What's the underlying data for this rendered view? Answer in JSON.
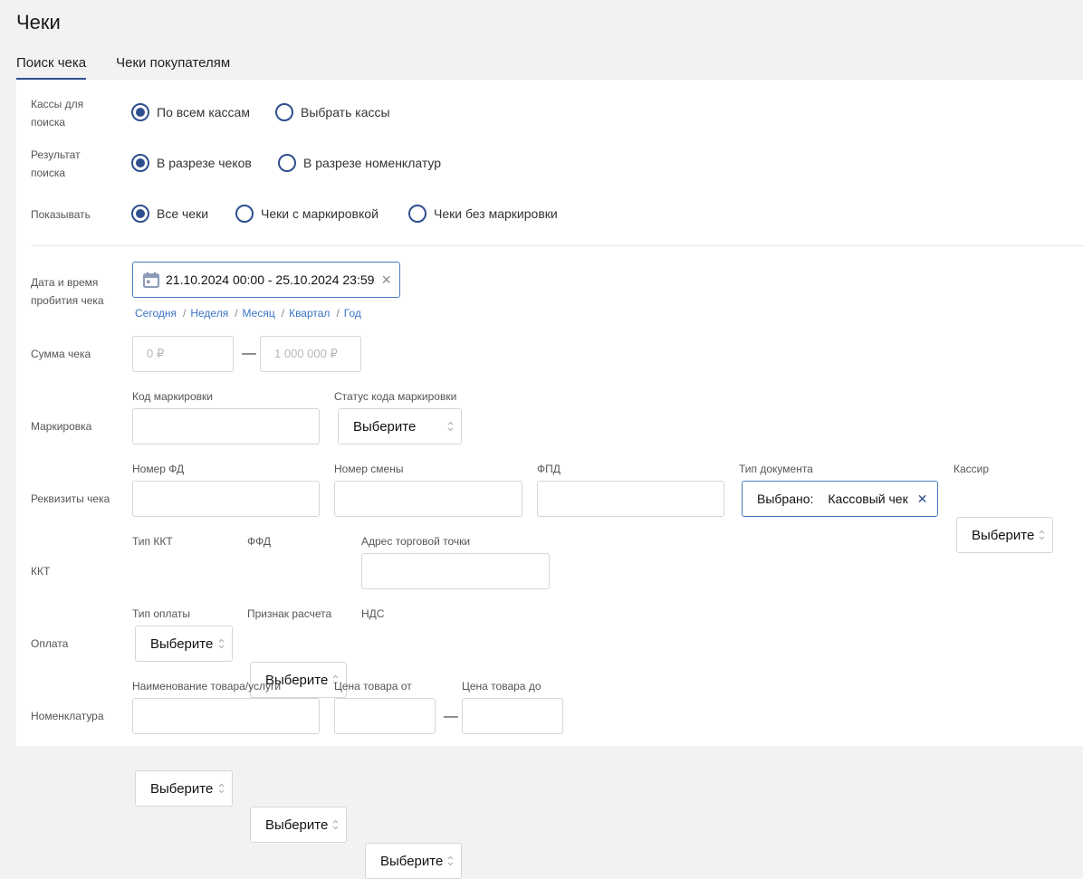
{
  "title": "Чеки",
  "tabs": [
    {
      "label": "Поиск чека"
    },
    {
      "label": "Чеки покупателям"
    }
  ],
  "filters": {
    "registers": {
      "label": "Кассы для поиска",
      "options": [
        "По всем кассам",
        "Выбрать кассы"
      ],
      "selected": "По всем кассам"
    },
    "result": {
      "label": "Результат поиска",
      "options": [
        "В разрезе чеков",
        "В разрезе номенклатур"
      ],
      "selected": "В разрезе чеков"
    },
    "show": {
      "label": "Показывать",
      "options": [
        "Все чеки",
        "Чеки с маркировкой",
        "Чеки без маркировки"
      ],
      "selected": "Все чеки"
    }
  },
  "date": {
    "label": "Дата и время пробития чека",
    "value": "21.10.2024 00:00 - 25.10.2024 23:59",
    "clear": "×",
    "quick": [
      "Сегодня",
      "Неделя",
      "Месяц",
      "Квартал",
      "Год"
    ],
    "sep": "/"
  },
  "sum": {
    "label": "Сумма чека",
    "from_placeholder": "0 ₽",
    "to_placeholder": "1 000 000 ₽",
    "dash": "—"
  },
  "marking": {
    "label": "Маркировка",
    "code_label": "Код маркировки",
    "status_label": "Статус кода маркировки",
    "status_value": "Выберите"
  },
  "requisites": {
    "label": "Реквизиты чека",
    "fd_label": "Номер ФД",
    "shift_label": "Номер смены",
    "fpd_label": "ФПД",
    "doc_type_label": "Тип документа",
    "doc_type_prefix": "Выбрано:",
    "doc_type_value": "Кассовый чек",
    "doc_type_clear": "✕",
    "cashier_label": "Кассир",
    "cashier_value": "Выберите"
  },
  "kkt": {
    "label": "ККТ",
    "type_label": "Тип ККТ",
    "type_value": "Выберите",
    "ffd_label": "ФФД",
    "ffd_value": "Выберите",
    "address_label": "Адрес торговой точки"
  },
  "payment": {
    "label": "Оплата",
    "type_label": "Тип оплаты",
    "type_value": "Выберите",
    "sign_label": "Признак расчета",
    "sign_value": "Выберите",
    "vat_label": "НДС",
    "vat_value": "Выберите"
  },
  "nomenclature": {
    "label": "Номенклатура",
    "name_label": "Наименование товара/услуги",
    "price_from_label": "Цена товара от",
    "price_to_label": "Цена товара до",
    "dash": "—"
  },
  "colors": {
    "accent": "#2e4f8e",
    "link": "#3a74c4",
    "focus_border": "#4a7cc1"
  }
}
